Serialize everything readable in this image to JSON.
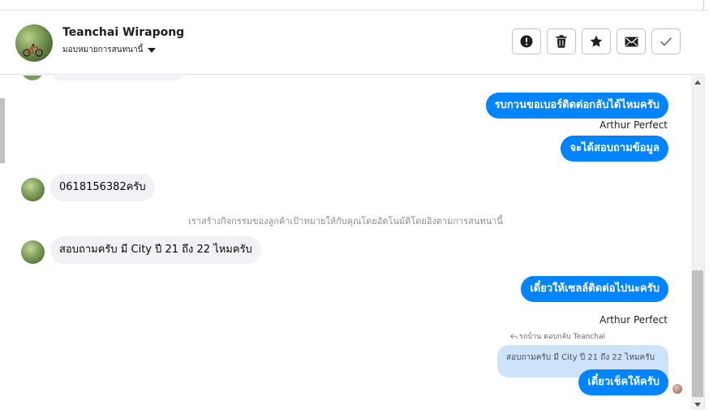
{
  "header": {
    "contact_name": "Teanchai Wirapong",
    "assign_label": "มอบหมายการสนทนานี้",
    "actions": [
      {
        "name": "report-spam",
        "icon": "exclamation-icon"
      },
      {
        "name": "delete",
        "icon": "trash-icon"
      },
      {
        "name": "star",
        "icon": "star-icon"
      },
      {
        "name": "mark-unread",
        "icon": "envelope-icon"
      },
      {
        "name": "done",
        "icon": "check-icon"
      }
    ]
  },
  "messages": {
    "out_1": "รบกวนขอเบอร์ติดต่อกลับได้ไหมครับ",
    "sender_1": "Arthur Perfect",
    "out_2": "จะได้สอบถามข้อมูล",
    "in_1": "0618156382ครับ",
    "system_note": "เราสร้างกิจกรรมของลูกค้าเป้าหมายให้กับคุณโดยอัตโนมัติโดยอิงตามการสนทนานี้",
    "in_2": "สอบถามครับ มี City ปี 21 ถึง 22 ไหมครับ",
    "out_3": "เดี๋ยวให้เซลล์ติดต่อไปนะครับ",
    "sender_2": "Arthur Perfect",
    "reply_context": "รถบ้าน ตอบกลับ Teanchai",
    "quoted_text": "สอบถามครับ มี City ปี 21 ถึง 22 ไหมครับ",
    "out_4": "เดี๋ยวเช็คให้ครับ"
  },
  "colors": {
    "outgoing_bubble": "#0084ff",
    "incoming_bubble": "#f0f2f5",
    "quoted_bubble": "#cce3f9"
  }
}
